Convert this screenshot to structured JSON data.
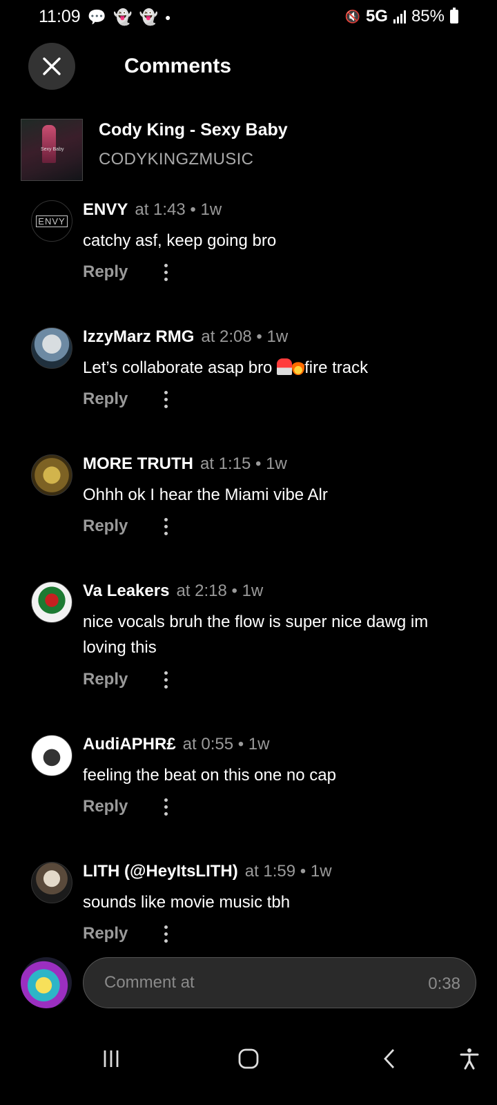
{
  "status": {
    "time": "11:09",
    "network": "5G",
    "battery": "85%",
    "icons": [
      "message-icon",
      "snapchat-icon",
      "snapchat-icon",
      "dot-icon",
      "mute-icon",
      "signal-icon",
      "battery-icon"
    ]
  },
  "header": {
    "title": "Comments",
    "close_icon": "close-icon"
  },
  "track": {
    "title": "Cody King - Sexy Baby",
    "artist": "CODYKINGZMUSIC",
    "art_text": "Sexy Baby"
  },
  "comments": [
    {
      "user": "ENVY",
      "meta": "at 1:43 • 1w",
      "text": "catchy asf, keep going bro",
      "avatar_text": "ENVY",
      "reply": "Reply"
    },
    {
      "user": "IzzyMarz RMG",
      "meta": "at 2:08 • 1w",
      "text_before": "Let’s collaborate asap bro ",
      "text_after": "fire track",
      "emojis": [
        "siren-emoji",
        "fire-emoji"
      ],
      "reply": "Reply"
    },
    {
      "user": "MORE TRUTH",
      "meta": "at 1:15 • 1w",
      "text": "Ohhh ok I hear the Miami vibe Alr",
      "reply": "Reply"
    },
    {
      "user": "Va Leakers",
      "meta": "at 2:18 • 1w",
      "text": "nice vocals bruh the flow is super nice dawg im loving this",
      "reply": "Reply"
    },
    {
      "user": "AudiAPHR£",
      "meta": "at 0:55 • 1w",
      "text": "feeling the beat on this one no cap",
      "reply": "Reply"
    },
    {
      "user": "LITH (@HeyItsLITH)",
      "meta": "at 1:59 • 1w",
      "text": "sounds like movie music tbh",
      "reply": "Reply"
    }
  ],
  "composer": {
    "placeholder": "Comment at",
    "timestamp": "0:38"
  },
  "navbar": {
    "icons": [
      "recents-icon",
      "home-icon",
      "back-icon",
      "accessibility-icon"
    ]
  }
}
